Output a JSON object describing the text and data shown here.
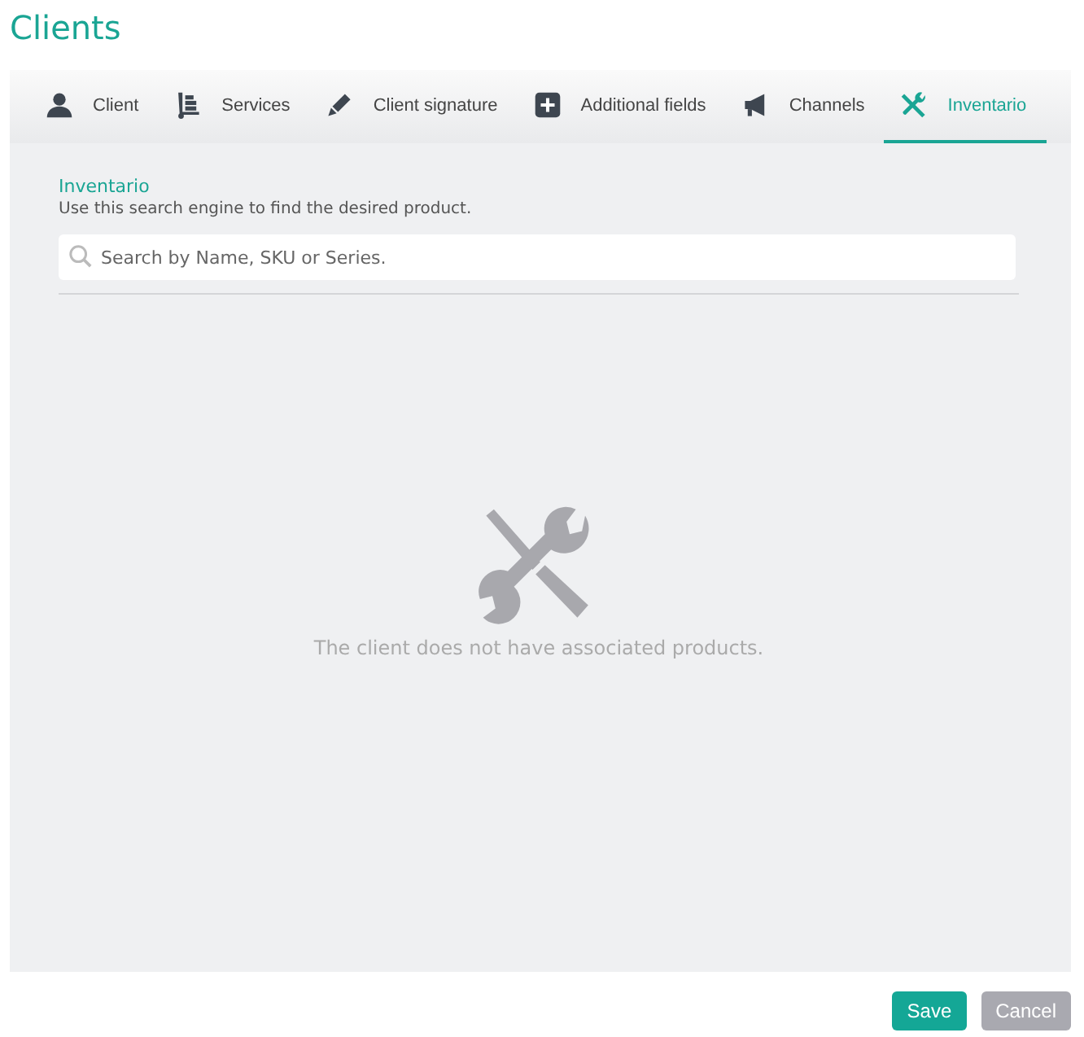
{
  "page_title": "Clients",
  "tabs": [
    {
      "label": "Client",
      "kind": "person",
      "selected": false
    },
    {
      "label": "Services",
      "kind": "cart",
      "selected": false
    },
    {
      "label": "Client signature",
      "kind": "pen",
      "selected": false
    },
    {
      "label": "Additional fields",
      "kind": "plus",
      "selected": false
    },
    {
      "label": "Channels",
      "kind": "megaphone",
      "selected": false
    },
    {
      "label": "Inventario",
      "kind": "tools",
      "selected": true
    }
  ],
  "section": {
    "title": "Inventario",
    "description": "Use this search engine to find the desired product."
  },
  "search": {
    "placeholder": "Search by Name, SKU or Series."
  },
  "empty_state": {
    "message": "The client does not have associated products."
  },
  "buttons": [
    {
      "label": "Save",
      "kind": "primary"
    },
    {
      "label": "Cancel",
      "kind": "secondary"
    }
  ]
}
